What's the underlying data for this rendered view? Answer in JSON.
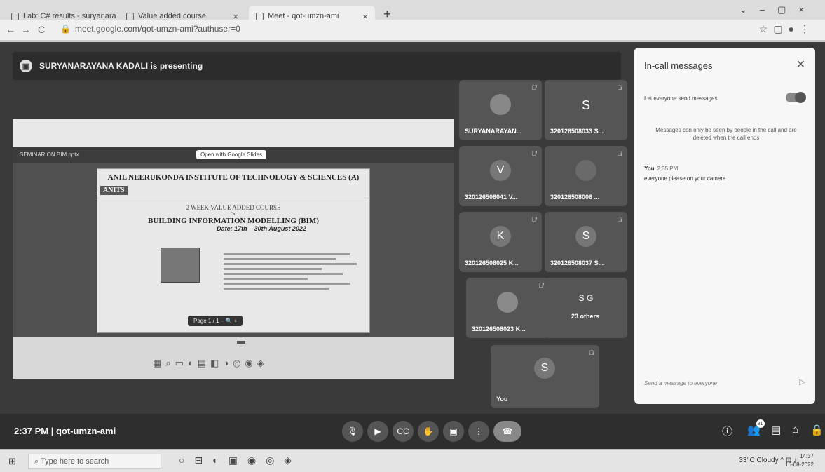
{
  "browser": {
    "tabs": [
      {
        "label": "Lab: C# results - suryanarayana.k..."
      },
      {
        "label": "Value added course"
      },
      {
        "label": "Meet - qot-umzn-ami"
      }
    ],
    "url": "meet.google.com/qot-umzn-ami?authuser=0"
  },
  "presenting_text": "SURYANARAYANA KADALI is presenting",
  "shared_screen": {
    "viewer_file": "SEMINAR ON BIM.pptx",
    "open_with": "Open with Google Slides",
    "institute": "ANIL NEERUKONDA INSTITUTE OF TECHNOLOGY & SCIENCES (A)",
    "logo": "ANITS",
    "course_line": "2 WEEK VALUE ADDED COURSE",
    "on": "On",
    "course_title": "BUILDING INFORMATION MODELLING (BIM)",
    "date": "Date: 17th – 30th August 2022",
    "page_label": "Page",
    "page_value": "1",
    "page_sep": "/",
    "page_total": "1"
  },
  "tiles": [
    {
      "name": "SURYANARAYAN...",
      "initial": ""
    },
    {
      "name": "320126508033 S...",
      "initial": "S"
    },
    {
      "name": "320126508041 V...",
      "initial": "V"
    },
    {
      "name": "320126508006 ...",
      "initial": ""
    },
    {
      "name": "320126508025 K...",
      "initial": "K"
    },
    {
      "name": "320126508037 S...",
      "initial": "S"
    },
    {
      "name": "320126508023 K...",
      "initial": ""
    },
    {
      "name": "23 others",
      "initial": "S G"
    }
  ],
  "self_tile": {
    "name": "You",
    "initial": "S"
  },
  "meeting_info": "2:37 PM | qot-umzn-ami",
  "participants_count": "31",
  "panel": {
    "title": "In-call messages",
    "toggle_label": "Let everyone send messages",
    "notice": "Messages can only be seen by people in the call and are deleted when the call ends",
    "sender": "You",
    "time": "2:35 PM",
    "message": "everyone please on your camera",
    "compose_placeholder": "Send a message to everyone"
  },
  "taskbar": {
    "search_placeholder": "Type here to search",
    "weather": "33°C Cloudy",
    "time": "14:37",
    "date": "16-08-2022"
  }
}
